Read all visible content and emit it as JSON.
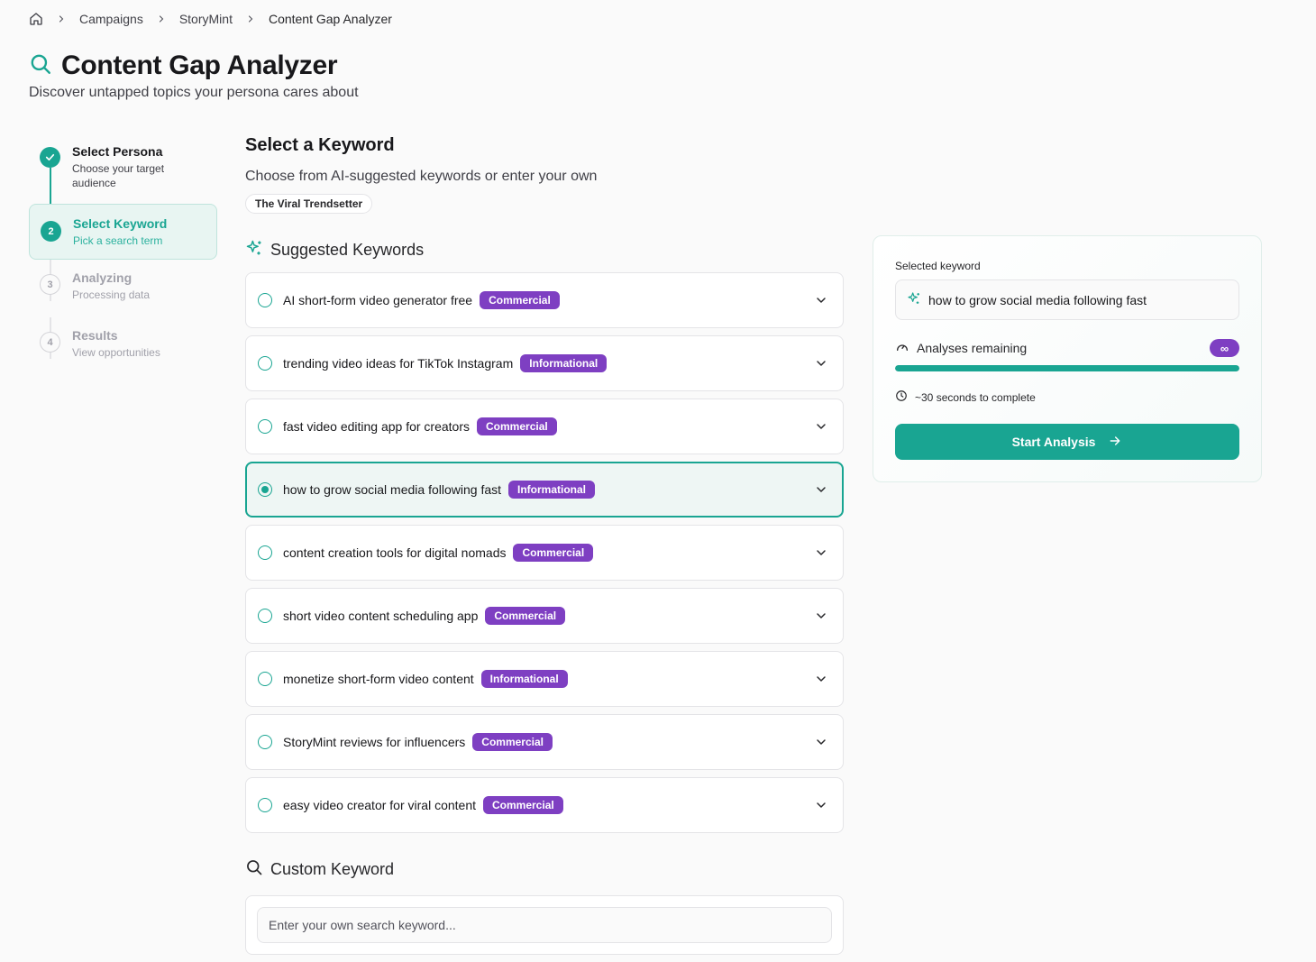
{
  "breadcrumb": {
    "home_icon": "home-icon",
    "items": [
      "Campaigns",
      "StoryMint",
      "Content Gap Analyzer"
    ]
  },
  "header": {
    "title": "Content Gap Analyzer",
    "subtitle": "Discover untapped topics your persona cares about",
    "icon": "search-icon"
  },
  "stepper": {
    "steps": [
      {
        "number": "1",
        "title": "Select Persona",
        "subtitle": "Choose your target audience",
        "status": "done"
      },
      {
        "number": "2",
        "title": "Select Keyword",
        "subtitle": "Pick a search term",
        "status": "active"
      },
      {
        "number": "3",
        "title": "Analyzing",
        "subtitle": "Processing data",
        "status": "pending"
      },
      {
        "number": "4",
        "title": "Results",
        "subtitle": "View opportunities",
        "status": "pending"
      }
    ]
  },
  "main": {
    "title": "Select a Keyword",
    "description": "Choose from AI-suggested keywords or enter your own",
    "persona_chip": "The Viral Trendsetter",
    "suggested_title": "Suggested Keywords",
    "keywords": [
      {
        "text": "AI short-form video generator free",
        "intent": "Commercial",
        "selected": false
      },
      {
        "text": "trending video ideas for TikTok Instagram",
        "intent": "Informational",
        "selected": false
      },
      {
        "text": "fast video editing app for creators",
        "intent": "Commercial",
        "selected": false
      },
      {
        "text": "how to grow social media following fast",
        "intent": "Informational",
        "selected": true
      },
      {
        "text": "content creation tools for digital nomads",
        "intent": "Commercial",
        "selected": false
      },
      {
        "text": "short video content scheduling app",
        "intent": "Commercial",
        "selected": false
      },
      {
        "text": "monetize short-form video content",
        "intent": "Informational",
        "selected": false
      },
      {
        "text": "StoryMint reviews for influencers",
        "intent": "Commercial",
        "selected": false
      },
      {
        "text": "easy video creator for viral content",
        "intent": "Commercial",
        "selected": false
      }
    ],
    "custom_title": "Custom Keyword",
    "custom_placeholder": "Enter your own search keyword..."
  },
  "side_card": {
    "selected_label": "Selected keyword",
    "selected_value": "how to grow social media following fast",
    "remaining_label": "Analyses remaining",
    "remaining_value": "∞",
    "remaining_fraction": 1.0,
    "time_label": "~30 seconds to complete",
    "button_label": "Start Analysis"
  },
  "colors": {
    "accent": "#19a592",
    "badge": "#7e3fc2",
    "background": "#fafafa"
  }
}
